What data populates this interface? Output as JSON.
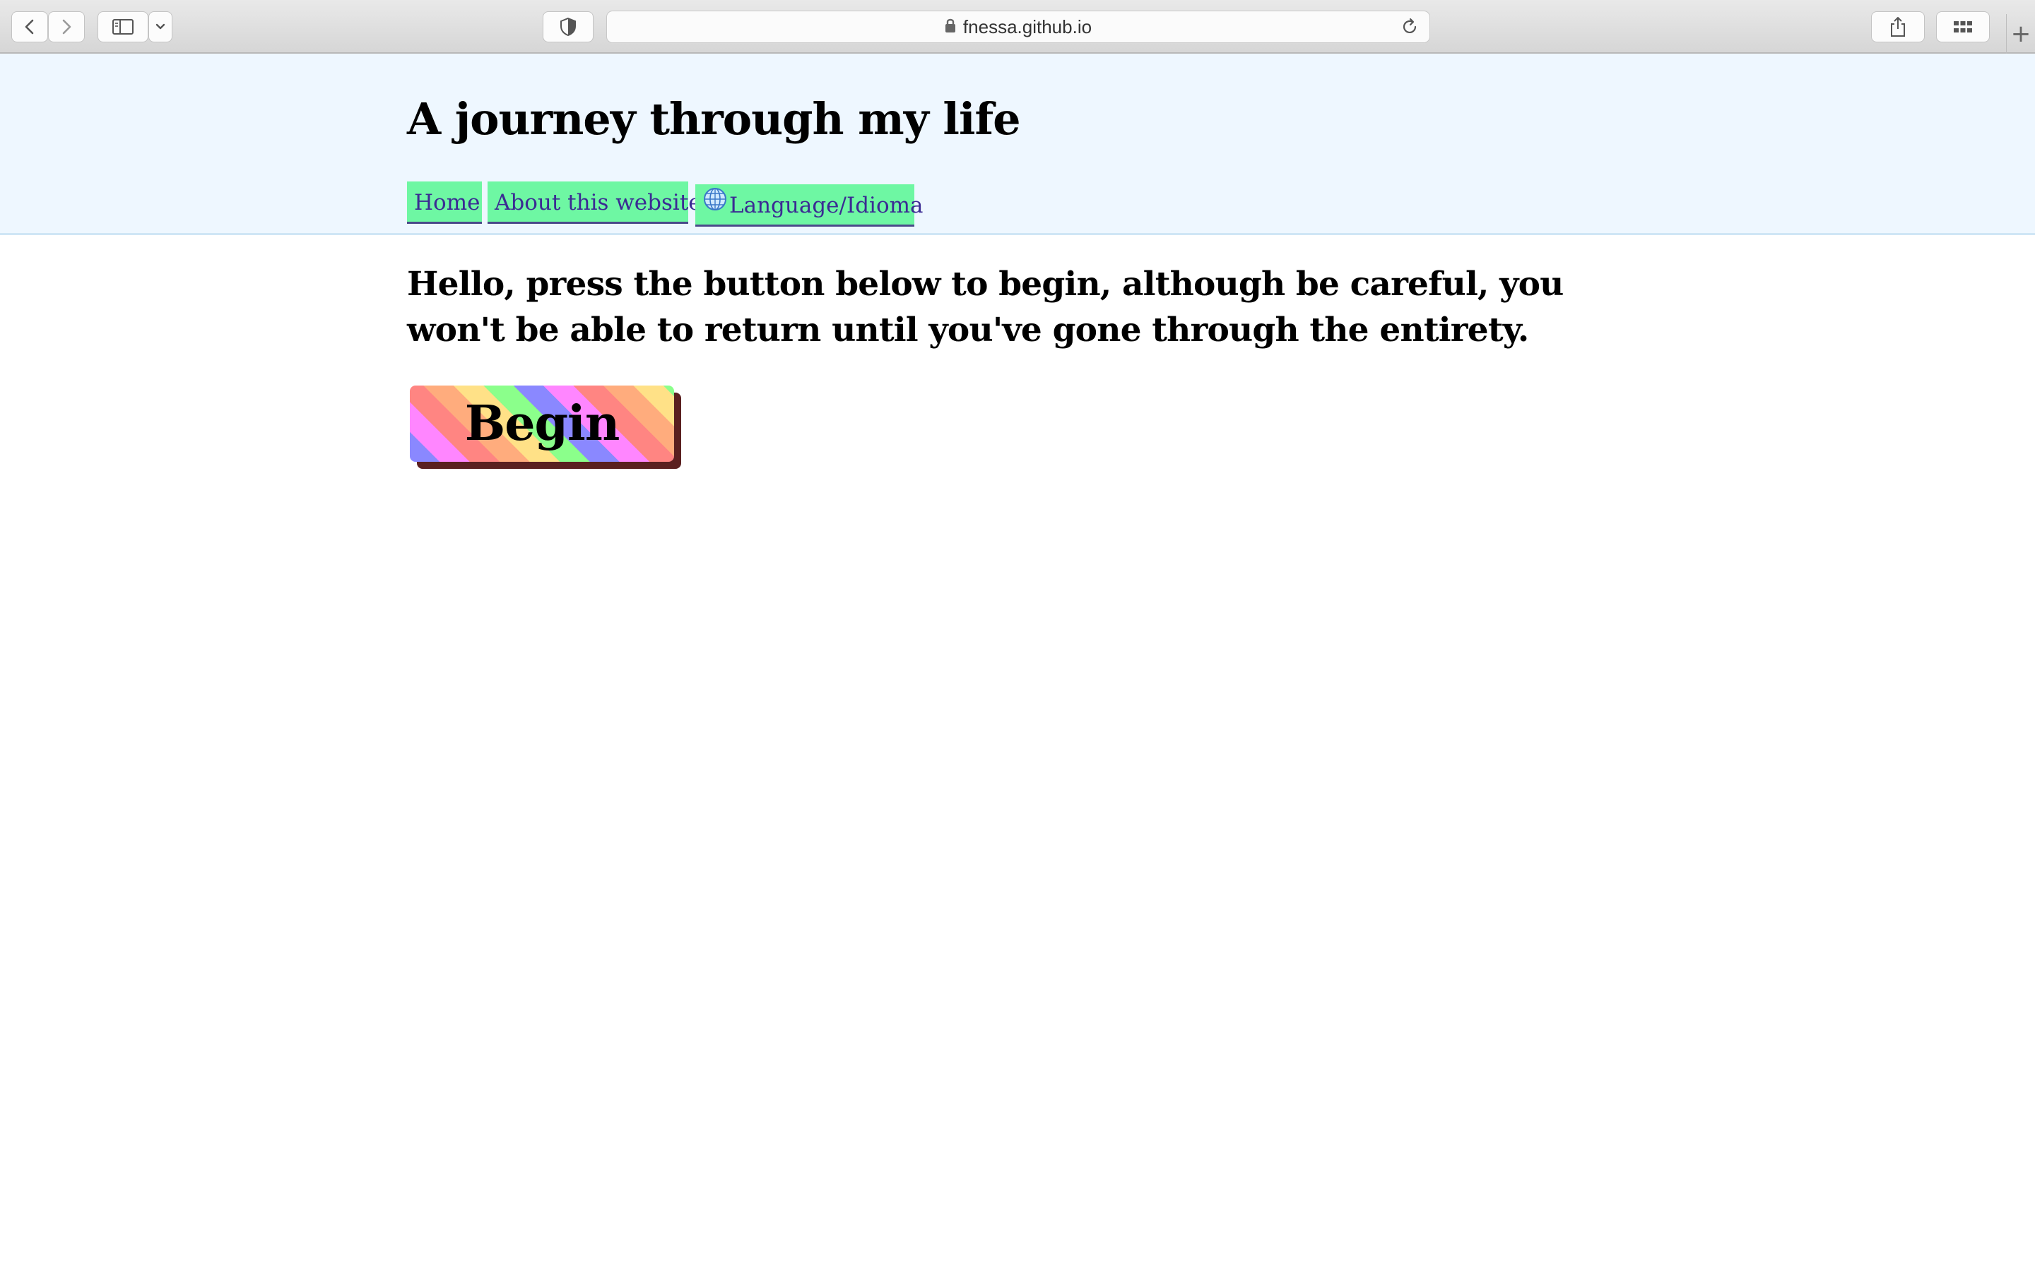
{
  "browser": {
    "url": "fnessa.github.io",
    "icons": {
      "back": "chevron-left-icon",
      "forward": "chevron-right-icon",
      "sidebar": "sidebar-icon",
      "sidebar_menu": "chevron-down-icon",
      "privacy": "shield-icon",
      "lock": "lock-icon",
      "reload": "reload-icon",
      "share": "share-icon",
      "tabs": "grid-icon",
      "new_tab": "plus-icon"
    },
    "new_tab_label": "+"
  },
  "site": {
    "title": "A journey through my life",
    "nav": [
      {
        "label": "Home"
      },
      {
        "label": "About this website"
      },
      {
        "label": "Language/Idioma",
        "icon": "globe-icon"
      }
    ]
  },
  "main": {
    "intro": "Hello, press the button below to begin, although be careful, you won't be able to return until you've gone through the entirety.",
    "begin_label": "Begin"
  },
  "colors": {
    "header_bg": "#eef7ff",
    "nav_bg": "#6ef7a3",
    "nav_text": "#3b2b93",
    "button_shadow": "#5a2020",
    "rainbow": [
      "#8a88ff",
      "#ff86ff",
      "#ff8582",
      "#ffac7d",
      "#ffe187",
      "#8bff8b"
    ]
  }
}
